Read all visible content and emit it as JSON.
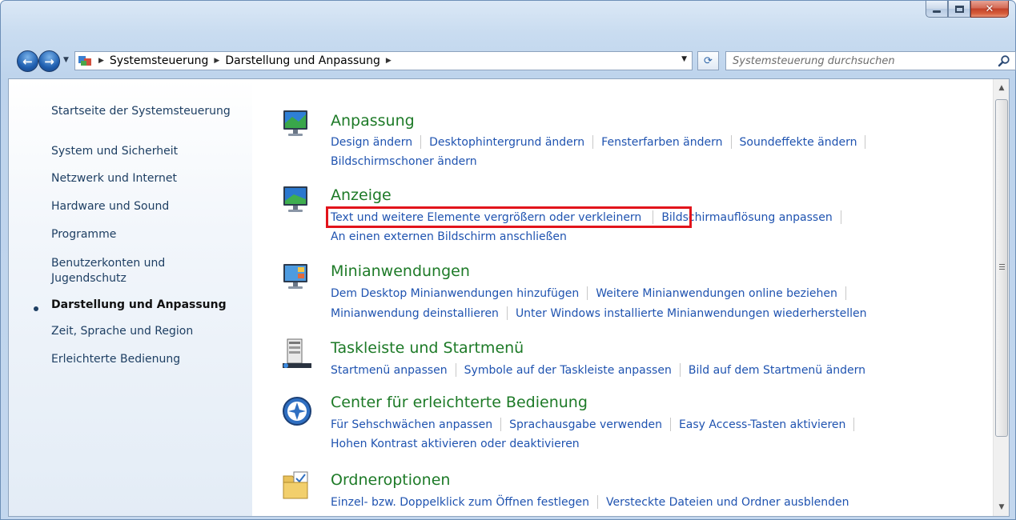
{
  "window": {
    "minimize_glyph": "",
    "maximize_glyph": "",
    "close_glyph": "✕"
  },
  "nav": {
    "back_glyph": "←",
    "forward_glyph": "→",
    "recent_glyph": "▼",
    "breadcrumbs": [
      "Systemsteuerung",
      "Darstellung und Anpassung"
    ],
    "crumb_separator": "▶",
    "dropdown_glyph": "▼",
    "refresh_glyph": "⟳"
  },
  "search": {
    "placeholder": "Systemsteuerung durchsuchen"
  },
  "sidebar": {
    "home": "Startseite der Systemsteuerung",
    "items": [
      "System und Sicherheit",
      "Netzwerk und Internet",
      "Hardware und Sound",
      "Programme",
      "Benutzerkonten und Jugendschutz",
      "Darstellung und Anpassung",
      "Zeit, Sprache und Region",
      "Erleichterte Bedienung"
    ],
    "active_index": 5
  },
  "categories": [
    {
      "title": "Anpassung",
      "icon": "monitor-personalize-icon",
      "lines": [
        [
          "Design ändern",
          "Desktophintergrund ändern",
          "Fensterfarben ändern",
          "Soundeffekte ändern"
        ],
        [
          "Bildschirmschoner ändern"
        ]
      ]
    },
    {
      "title": "Anzeige",
      "icon": "monitor-display-icon",
      "lines": [
        [
          "Text und weitere Elemente vergrößern oder verkleinern",
          "Bildschirmauflösung anpassen"
        ],
        [
          "An einen externen Bildschirm anschließen"
        ]
      ]
    },
    {
      "title": "Minianwendungen",
      "icon": "gadgets-icon",
      "lines": [
        [
          "Dem Desktop Minianwendungen hinzufügen",
          "Weitere Minianwendungen online beziehen"
        ],
        [
          "Minianwendung deinstallieren",
          "Unter Windows installierte Minianwendungen wiederherstellen"
        ]
      ]
    },
    {
      "title": "Taskleiste und Startmenü",
      "icon": "taskbar-icon",
      "lines": [
        [
          "Startmenü anpassen",
          "Symbole auf der Taskleiste anpassen",
          "Bild auf dem Startmenü ändern"
        ]
      ]
    },
    {
      "title": "Center für erleichterte Bedienung",
      "icon": "ease-of-access-icon",
      "lines": [
        [
          "Für Sehschwächen anpassen",
          "Sprachausgabe verwenden",
          "Easy Access-Tasten aktivieren"
        ],
        [
          "Hohen Kontrast aktivieren oder deaktivieren"
        ]
      ]
    },
    {
      "title": "Ordneroptionen",
      "icon": "folder-options-icon",
      "lines": [
        [
          "Einzel- bzw. Doppelklick zum Öffnen festlegen",
          "Versteckte Dateien und Ordner ausblenden"
        ]
      ]
    }
  ],
  "colors": {
    "category_title": "#1d7a27",
    "link": "#1f53b0",
    "highlight": "#e2141b"
  }
}
